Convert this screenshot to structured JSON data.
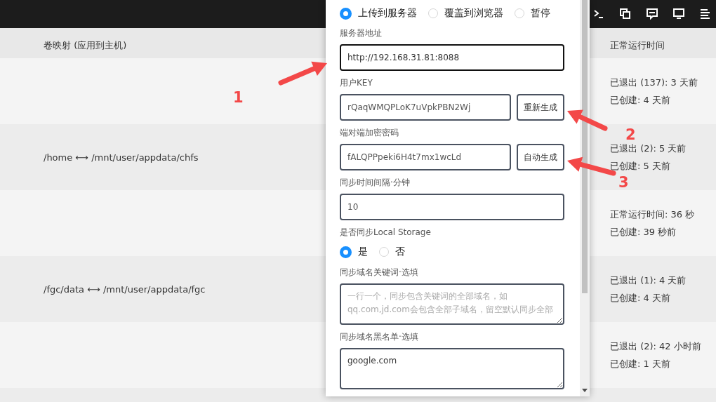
{
  "table": {
    "columns": [
      "卷映射 (应用到主机)",
      "正常运行时间"
    ],
    "rows": [
      {
        "volume": "",
        "uptime": [
          "已退出 (137): 3 天前",
          "已创建: 4 天前"
        ]
      },
      {
        "volume": "/home ⟷ /mnt/user/appdata/chfs",
        "uptime": [
          "已退出 (2): 5 天前",
          "已创建: 5 天前"
        ]
      },
      {
        "volume": "",
        "uptime": [
          "正常运行时间: 36 秒",
          "已创建: 39 秒前"
        ]
      },
      {
        "volume": "/fgc/data ⟷ /mnt/user/appdata/fgc",
        "uptime": [
          "已退出 (1): 4 天前",
          "已创建: 4 天前"
        ]
      },
      {
        "volume": "",
        "uptime": [
          "已退出 (2): 42 小时前",
          "已创建: 1 天前"
        ]
      }
    ]
  },
  "panel": {
    "modes": [
      {
        "label": "上传到服务器",
        "selected": true
      },
      {
        "label": "覆盖到浏览器",
        "selected": false
      },
      {
        "label": "暂停",
        "selected": false
      }
    ],
    "fields": [
      {
        "kind": "input",
        "label": "服务器地址",
        "value": "http://192.168.31.81:8088",
        "focused": true
      },
      {
        "kind": "input_button",
        "label": "用户KEY",
        "value": "rQaqWMQPLoK7uVpkPBN2Wj",
        "focused": false,
        "button": "重新生成"
      },
      {
        "kind": "input_button",
        "label": "端对端加密密码",
        "value": "fALQPPpeki6H4t7mx1wcLd",
        "focused": false,
        "button": "自动生成"
      },
      {
        "kind": "input",
        "label": "同步时间间隔·分钟",
        "value": "10",
        "focused": false
      },
      {
        "kind": "radio",
        "label": "是否同步Local Storage",
        "options": [
          {
            "label": "是",
            "selected": true
          },
          {
            "label": "否",
            "selected": false
          }
        ]
      },
      {
        "kind": "textarea",
        "label": "同步域名关键词·选填",
        "placeholder": "一行一个，同步包含关键词的全部域名，如qq.com,jd.com会包含全部子域名，留空默认同步全部"
      },
      {
        "kind": "textarea",
        "label": "同步域名黑名单·选填",
        "value": "google.com"
      }
    ]
  },
  "annotations": [
    {
      "number": "1"
    },
    {
      "number": "2"
    },
    {
      "number": "3"
    }
  ]
}
